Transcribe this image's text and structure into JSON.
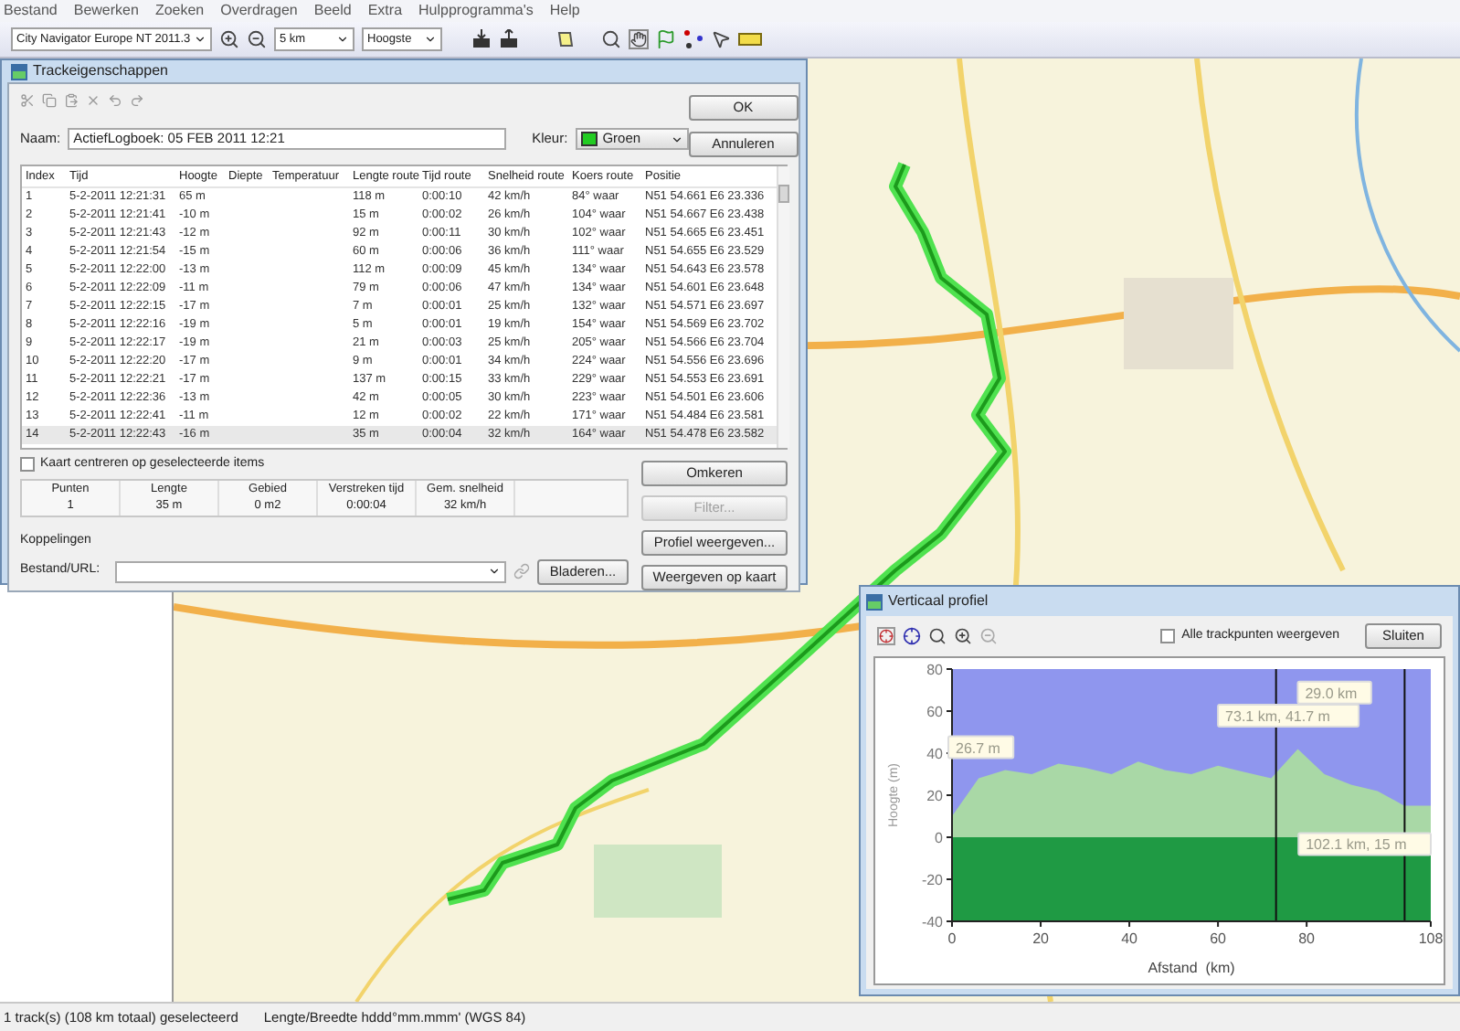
{
  "menu": [
    "Bestand",
    "Bewerken",
    "Zoeken",
    "Overdragen",
    "Beeld",
    "Extra",
    "Hulpprogramma's",
    "Help"
  ],
  "toolbar": {
    "map_product": "City Navigator Europe NT 2011.3",
    "zoom": "5 km",
    "detail": "Hoogste"
  },
  "track_dialog": {
    "title": "Trackeigenschappen",
    "name_label": "Naam:",
    "name_value": "ActiefLogboek: 05 FEB 2011 12:21",
    "color_label": "Kleur:",
    "color_value": "Groen",
    "buttons": [
      {
        "label": "OK",
        "disabled": false
      },
      {
        "label": "Annuleren",
        "disabled": false
      }
    ],
    "columns": [
      "Index",
      "Tijd",
      "Hoogte",
      "Diepte",
      "Temperatuur",
      "Lengte route",
      "Tijd route",
      "Snelheid route",
      "Koers route",
      "Positie"
    ],
    "rows": [
      {
        "index": "1",
        "time": "5-2-2011 12:21:31",
        "altitude": "65 m",
        "leg_length": "118 m",
        "leg_time": "0:00:10",
        "leg_speed": "42 km/h",
        "leg_course": "84° waar",
        "position": "N51 54.661 E6 23.336",
        "selected": false
      },
      {
        "index": "2",
        "time": "5-2-2011 12:21:41",
        "altitude": "-10 m",
        "leg_length": "15 m",
        "leg_time": "0:00:02",
        "leg_speed": "26 km/h",
        "leg_course": "104° waar",
        "position": "N51 54.667 E6 23.438",
        "selected": false
      },
      {
        "index": "3",
        "time": "5-2-2011 12:21:43",
        "altitude": "-12 m",
        "leg_length": "92 m",
        "leg_time": "0:00:11",
        "leg_speed": "30 km/h",
        "leg_course": "102° waar",
        "position": "N51 54.665 E6 23.451",
        "selected": false
      },
      {
        "index": "4",
        "time": "5-2-2011 12:21:54",
        "altitude": "-15 m",
        "leg_length": "60 m",
        "leg_time": "0:00:06",
        "leg_speed": "36 km/h",
        "leg_course": "111° waar",
        "position": "N51 54.655 E6 23.529",
        "selected": false
      },
      {
        "index": "5",
        "time": "5-2-2011 12:22:00",
        "altitude": "-13 m",
        "leg_length": "112 m",
        "leg_time": "0:00:09",
        "leg_speed": "45 km/h",
        "leg_course": "134° waar",
        "position": "N51 54.643 E6 23.578",
        "selected": false
      },
      {
        "index": "6",
        "time": "5-2-2011 12:22:09",
        "altitude": "-11 m",
        "leg_length": "79 m",
        "leg_time": "0:00:06",
        "leg_speed": "47 km/h",
        "leg_course": "134° waar",
        "position": "N51 54.601 E6 23.648",
        "selected": false
      },
      {
        "index": "7",
        "time": "5-2-2011 12:22:15",
        "altitude": "-17 m",
        "leg_length": "7 m",
        "leg_time": "0:00:01",
        "leg_speed": "25 km/h",
        "leg_course": "132° waar",
        "position": "N51 54.571 E6 23.697",
        "selected": false
      },
      {
        "index": "8",
        "time": "5-2-2011 12:22:16",
        "altitude": "-19 m",
        "leg_length": "5 m",
        "leg_time": "0:00:01",
        "leg_speed": "19 km/h",
        "leg_course": "154° waar",
        "position": "N51 54.569 E6 23.702",
        "selected": false
      },
      {
        "index": "9",
        "time": "5-2-2011 12:22:17",
        "altitude": "-19 m",
        "leg_length": "21 m",
        "leg_time": "0:00:03",
        "leg_speed": "25 km/h",
        "leg_course": "205° waar",
        "position": "N51 54.566 E6 23.704",
        "selected": false
      },
      {
        "index": "10",
        "time": "5-2-2011 12:22:20",
        "altitude": "-17 m",
        "leg_length": "9 m",
        "leg_time": "0:00:01",
        "leg_speed": "34 km/h",
        "leg_course": "224° waar",
        "position": "N51 54.556 E6 23.696",
        "selected": false
      },
      {
        "index": "11",
        "time": "5-2-2011 12:22:21",
        "altitude": "-17 m",
        "leg_length": "137 m",
        "leg_time": "0:00:15",
        "leg_speed": "33 km/h",
        "leg_course": "229° waar",
        "position": "N51 54.553 E6 23.691",
        "selected": false
      },
      {
        "index": "12",
        "time": "5-2-2011 12:22:36",
        "altitude": "-13 m",
        "leg_length": "42 m",
        "leg_time": "0:00:05",
        "leg_speed": "30 km/h",
        "leg_course": "223° waar",
        "position": "N51 54.501 E6 23.606",
        "selected": false
      },
      {
        "index": "13",
        "time": "5-2-2011 12:22:41",
        "altitude": "-11 m",
        "leg_length": "12 m",
        "leg_time": "0:00:02",
        "leg_speed": "22 km/h",
        "leg_course": "171° waar",
        "position": "N51 54.484 E6 23.581",
        "selected": false
      },
      {
        "index": "14",
        "time": "5-2-2011 12:22:43",
        "altitude": "-16 m",
        "leg_length": "35 m",
        "leg_time": "0:00:04",
        "leg_speed": "32 km/h",
        "leg_course": "164° waar",
        "position": "N51 54.478 E6 23.582",
        "selected": true
      }
    ],
    "center_checkbox": {
      "label": "Kaart centreren op geselecteerde items",
      "checked": false
    },
    "summary": {
      "columns": [
        "Punten",
        "Lengte",
        "Gebied",
        "Verstreken tijd",
        "Gem. snelheid"
      ],
      "values": [
        "1",
        "35 m",
        "0 m2",
        "0:00:04",
        "32 km/h"
      ]
    },
    "links_label": "Koppelingen",
    "file_label": "Bestand/URL:",
    "browse_button": "Bladeren...",
    "side_buttons": [
      {
        "label": "Omkeren",
        "disabled": false
      },
      {
        "label": "Filter...",
        "disabled": true
      },
      {
        "label": "Profiel weergeven...",
        "disabled": false
      },
      {
        "label": "Weergeven op kaart",
        "disabled": false
      }
    ]
  },
  "profile_window": {
    "title": "Verticaal profiel",
    "all_points_checkbox": {
      "label": "Alle trackpunten weergeven",
      "checked": false
    },
    "close_button": "Sluiten",
    "chart_data": {
      "type": "area",
      "xlabel": "Afstand  (km)",
      "ylabel": "Hoogte (m)",
      "x": [
        0,
        6,
        12,
        18,
        24,
        30,
        36,
        42,
        48,
        54,
        60,
        66,
        72,
        78,
        84,
        90,
        96,
        102,
        108
      ],
      "series": [
        {
          "color": "#a9d8a6",
          "values": [
            10,
            28,
            32,
            30,
            35,
            33,
            30,
            36,
            32,
            30,
            34,
            31,
            28,
            42,
            30,
            25,
            22,
            15,
            15
          ]
        }
      ],
      "bands": [
        {
          "axis": "y",
          "from": -40,
          "to": 0,
          "color": "#1f9a44"
        }
      ],
      "ref_lines": [
        {
          "axis": "x",
          "value": 73.1
        },
        {
          "axis": "x",
          "value": 102.1
        }
      ],
      "xlim": [
        0,
        108
      ],
      "ylim": [
        -40,
        80
      ],
      "xticks": [
        0,
        20,
        40,
        60,
        80,
        108
      ],
      "yticks": [
        -40,
        -20,
        0,
        20,
        40,
        60,
        80
      ],
      "annotations": [
        "26.7 m",
        "73.1 km, 41.7 m",
        "29.0 km",
        "102.1 km, 15 m"
      ]
    }
  },
  "status_bar": [
    "1 track(s) (108 km totaal) geselecteerd",
    "Lengte/Breedte hddd°mm.mmm' (WGS 84)"
  ]
}
